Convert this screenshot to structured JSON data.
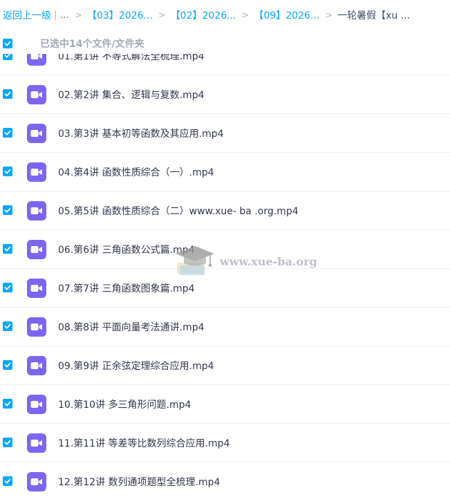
{
  "breadcrumb": {
    "back": "返回上一级",
    "pipe": "|",
    "ellipsis": "...",
    "separator": ">",
    "items": [
      "【03】2026...",
      "【02】2026...",
      "【09】2026..."
    ],
    "current": "一轮暑假【xu ..."
  },
  "selection": {
    "label": "已选中14个文件/文件夹",
    "checked": true
  },
  "watermark": {
    "text": "www.xue-ba.org"
  },
  "files": [
    {
      "name": "01.第1讲 不等式解法全梳理.mp4",
      "checked": true
    },
    {
      "name": "02.第2讲 集合、逻辑与复数.mp4",
      "checked": true
    },
    {
      "name": "03.第3讲 基本初等函数及其应用.mp4",
      "checked": true
    },
    {
      "name": "04.第4讲 函数性质综合（一）.mp4",
      "checked": true
    },
    {
      "name": "05.第5讲 函数性质综合（二）www.xue- ba .org.mp4",
      "checked": true
    },
    {
      "name": "06.第6讲 三角函数公式篇.mp4",
      "checked": true
    },
    {
      "name": "07.第7讲 三角函数图象篇.mp4",
      "checked": true
    },
    {
      "name": "08.第8讲 平面向量考法通讲.mp4",
      "checked": true
    },
    {
      "name": "09.第9讲 正余弦定理综合应用.mp4",
      "checked": true
    },
    {
      "name": "10.第10讲 多三角形问题.mp4",
      "checked": true
    },
    {
      "name": "11.第11讲 等差等比数列综合应用.mp4",
      "checked": true
    },
    {
      "name": "12.第12讲 数列通项题型全梳理.mp4",
      "checked": true
    }
  ],
  "colors": {
    "accent": "#06a7ff",
    "video_icon": "#7e64f3"
  },
  "icons": {
    "checkbox": "checkmark-icon",
    "file": "video-file-icon"
  }
}
